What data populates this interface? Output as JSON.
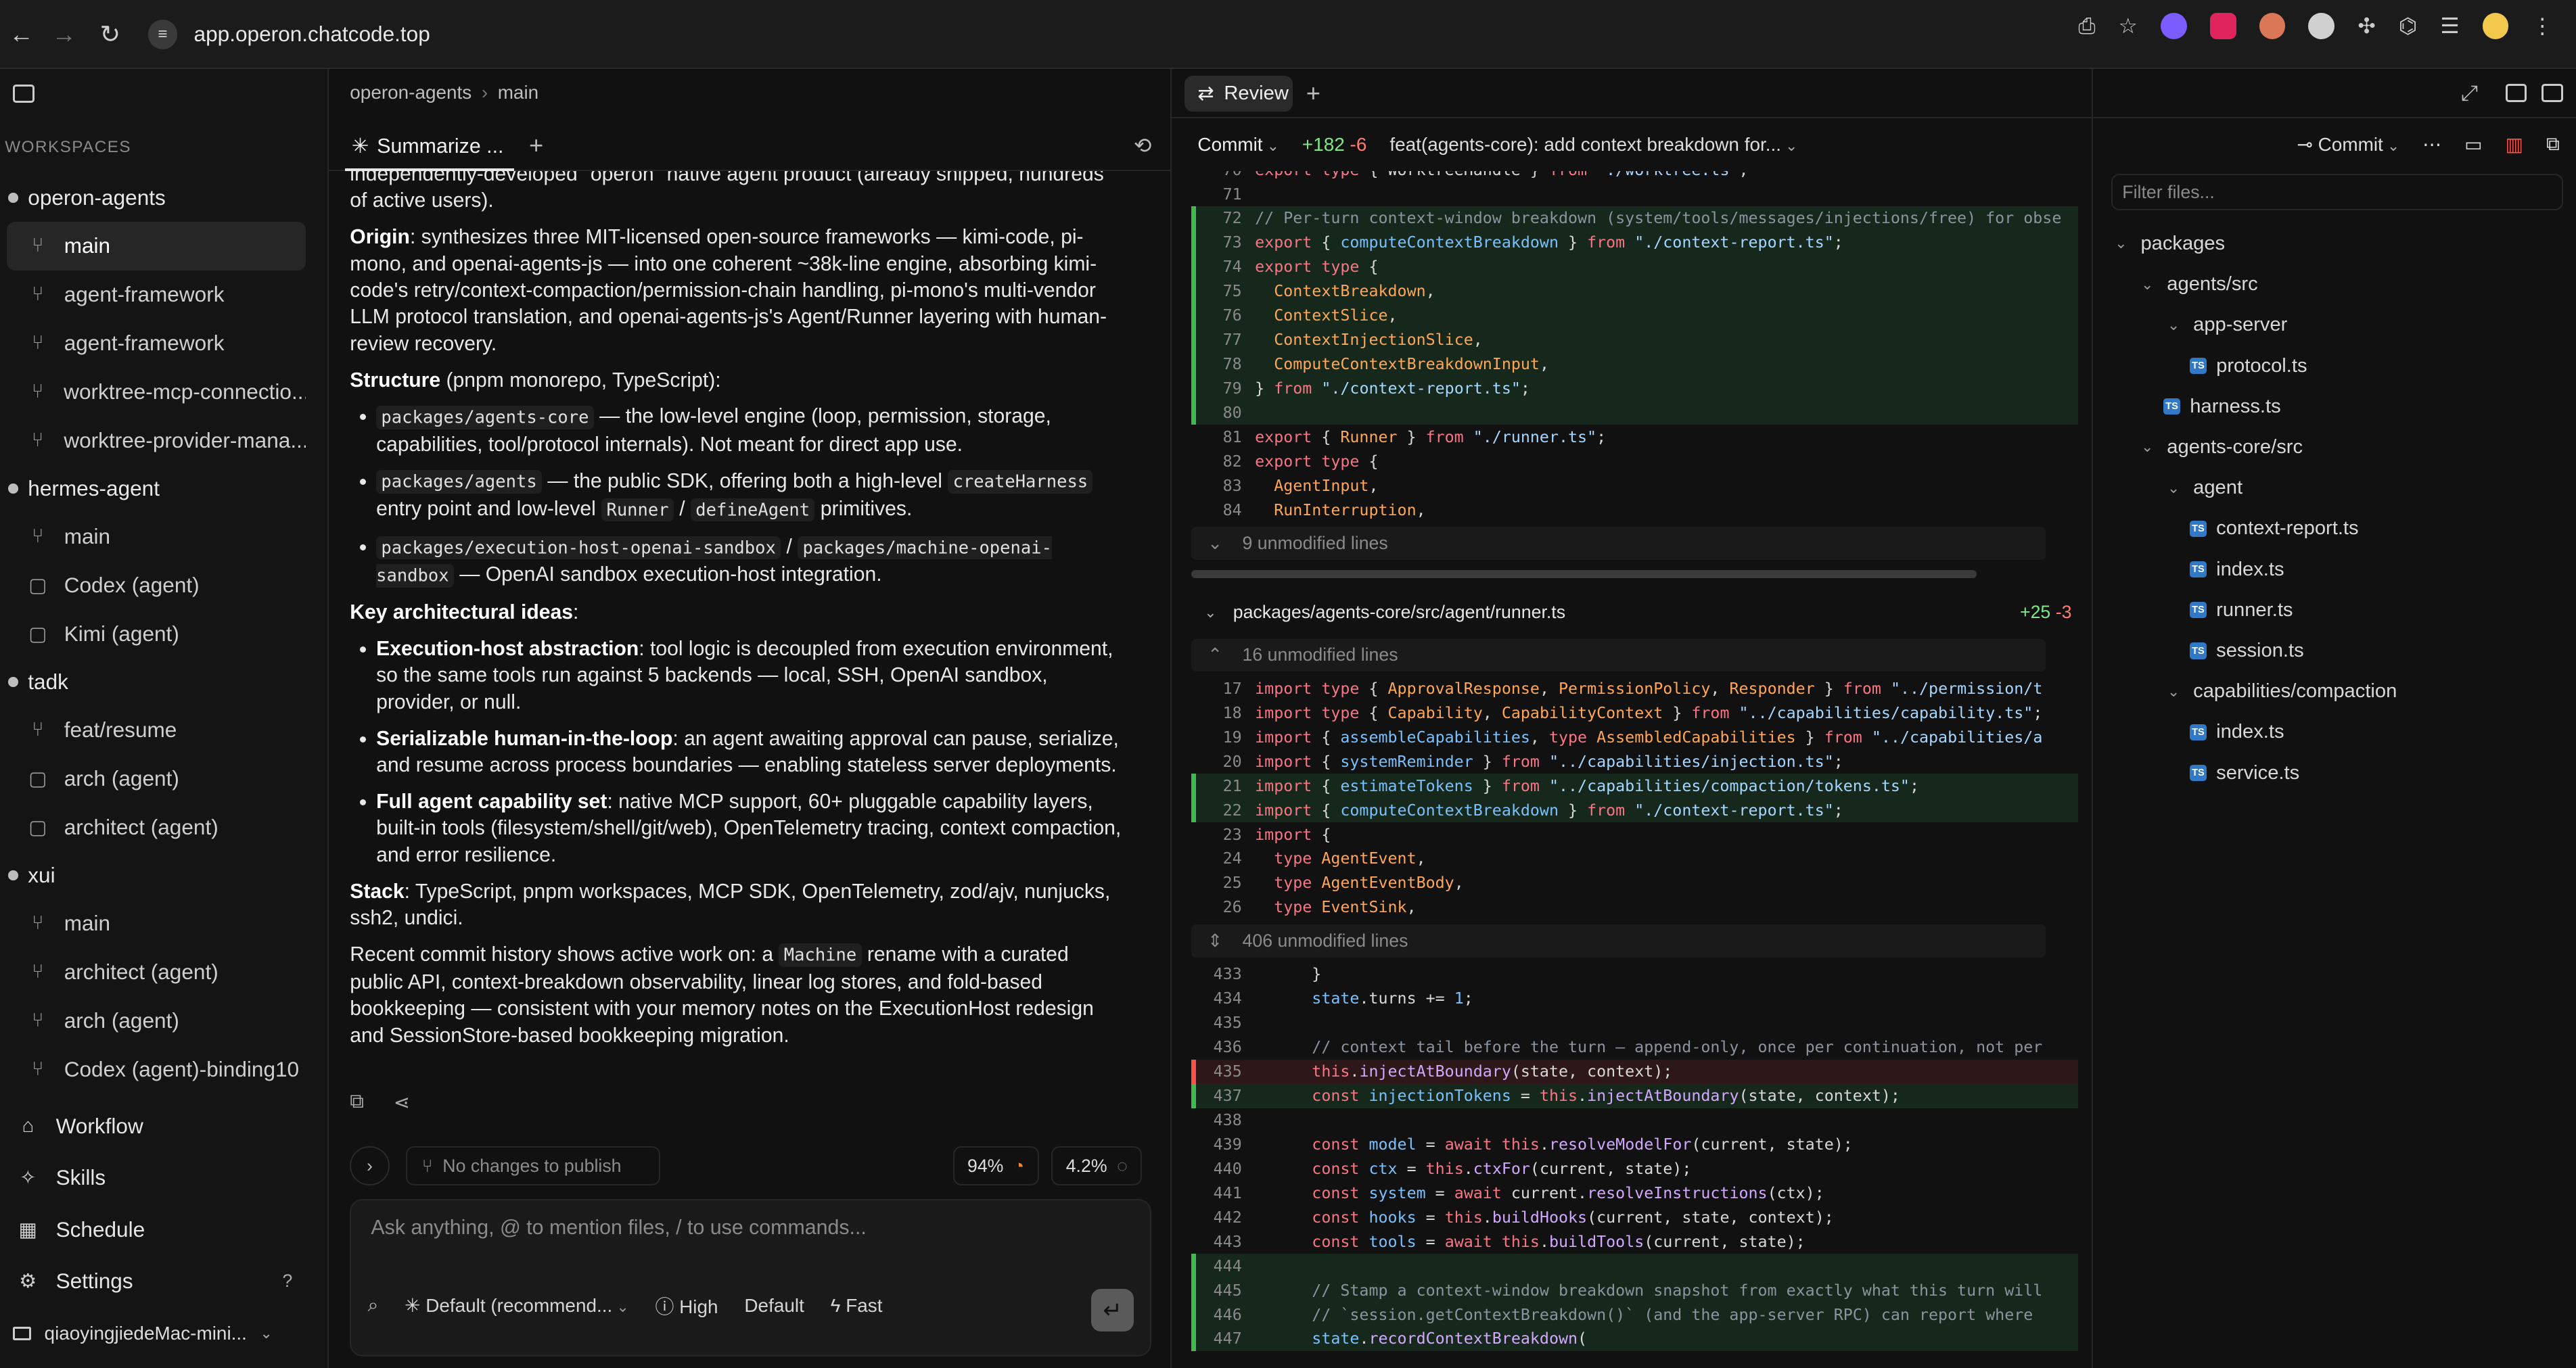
{
  "browser": {
    "url": "app.operon.chatcode.top"
  },
  "sidebar": {
    "section_label": "WORKSPACES",
    "workspaces": [
      {
        "name": "operon-agents",
        "branches": [
          {
            "label": "main",
            "icon": "branch-icon",
            "active": true
          },
          {
            "label": "agent-framework",
            "icon": "branch-icon"
          },
          {
            "label": "agent-framework",
            "icon": "branch-icon"
          },
          {
            "label": "worktree-mcp-connectio...",
            "icon": "branch-icon"
          },
          {
            "label": "worktree-provider-mana...",
            "icon": "branch-icon"
          }
        ]
      },
      {
        "name": "hermes-agent",
        "branches": [
          {
            "label": "main",
            "icon": "branch-icon"
          },
          {
            "label": "Codex (agent)",
            "icon": "briefcase-icon"
          },
          {
            "label": "Kimi (agent)",
            "icon": "briefcase-icon"
          }
        ]
      },
      {
        "name": "tadk",
        "branches": [
          {
            "label": "feat/resume",
            "icon": "branch-icon"
          },
          {
            "label": "arch (agent)",
            "icon": "briefcase-icon"
          },
          {
            "label": "architect (agent)",
            "icon": "briefcase-icon"
          }
        ]
      },
      {
        "name": "xui",
        "branches": [
          {
            "label": "main",
            "icon": "branch-icon"
          },
          {
            "label": "architect (agent)",
            "icon": "branch-icon"
          },
          {
            "label": "arch (agent)",
            "icon": "branch-icon"
          },
          {
            "label": "Codex (agent)-binding10",
            "icon": "branch-icon"
          }
        ]
      }
    ],
    "nav": {
      "workflow": "Workflow",
      "skills": "Skills",
      "schedule": "Schedule",
      "settings": "Settings",
      "help": "?"
    },
    "machine": "qiaoyingjiedeMac-mini..."
  },
  "chat": {
    "breadcrumb": {
      "repo": "operon-agents",
      "sep": "›",
      "branch": "main"
    },
    "tab_label": "Summarize ...",
    "body": {
      "intro_tail": "independently-developed \"operon\" native agent product (already shipped, hundreds of active users).",
      "origin_label": "Origin",
      "origin_text": ": synthesizes three MIT-licensed open-source frameworks — kimi-code, pi-mono, and openai-agents-js — into one coherent ~38k-line engine, absorbing kimi-code's retry/context-compaction/permission-chain handling, pi-mono's multi-vendor LLM protocol translation, and openai-agents-js's Agent/Runner layering with human-review recovery.",
      "structure_label": "Structure",
      "structure_text": " (pnpm monorepo, TypeScript):",
      "s1_code": "packages/agents-core",
      "s1_text": " — the low-level engine (loop, permission, storage, capabilities, tool/protocol internals). Not meant for direct app use.",
      "s2_code": "packages/agents",
      "s2_text_a": " — the public SDK, offering both a high-level ",
      "s2_code2": "createHarness",
      "s2_text_b": " entry point and low-level ",
      "s2_code3": "Runner",
      "s2_slash": " / ",
      "s2_code4": "defineAgent",
      "s2_text_c": " primitives.",
      "s3_code": "packages/execution-host-openai-sandbox",
      "s3_slash": " / ",
      "s3_code2": "packages/machine-openai-sandbox",
      "s3_text": " — OpenAI sandbox execution-host integration.",
      "key_label": "Key architectural ideas",
      "key_colon": ":",
      "k1_label": "Execution-host abstraction",
      "k1_text": ": tool logic is decoupled from execution environment, so the same tools run against 5 backends — local, SSH, OpenAI sandbox, provider, or null.",
      "k2_label": "Serializable human-in-the-loop",
      "k2_text": ": an agent awaiting approval can pause, serialize, and resume across process boundaries — enabling stateless server deployments.",
      "k3_label": "Full agent capability set",
      "k3_text": ": native MCP support, 60+ pluggable capability layers, built-in tools (filesystem/shell/git/web), OpenTelemetry tracing, context compaction, and error resilience.",
      "stack_label": "Stack",
      "stack_text": ": TypeScript, pnpm workspaces, MCP SDK, OpenTelemetry, zod/ajv, nunjucks, ssh2, undici.",
      "recent_a": "Recent commit history shows active work on: a ",
      "recent_code": "Machine",
      "recent_b": " rename with a curated public API, context-breakdown observability, linear log stores, and fold-based bookkeeping — consistent with your memory notes on the ExecutionHost redesign and SessionStore-based bookkeeping migration."
    },
    "status": {
      "publish": "No changes to publish",
      "context_pct": "94%",
      "usage_pct": "4.2%"
    },
    "composer": {
      "placeholder": "Ask anything, @ to mention files, / to use commands...",
      "model": "Default (recommend...",
      "effort": "High",
      "mode": "Default",
      "speed": "Fast"
    }
  },
  "review": {
    "tab_label": "Review",
    "commit_label": "Commit",
    "additions": "+182",
    "deletions": "-6",
    "commit_title": "feat(agents-core): add context breakdown for...",
    "file2": {
      "path": "packages/agents-core/src/agent/runner.ts",
      "additions": "+25",
      "deletions": "-3"
    },
    "unmodified_1": "9 unmodified lines",
    "unmodified_2": "16 unmodified lines",
    "unmodified_3": "406 unmodified lines"
  },
  "files": {
    "commit_label": "Commit",
    "filter_placeholder": "Filter files...",
    "tree": [
      {
        "label": "packages",
        "depth": 0,
        "type": "folder"
      },
      {
        "label": "agents/src",
        "depth": 1,
        "type": "folder"
      },
      {
        "label": "app-server",
        "depth": 2,
        "type": "folder"
      },
      {
        "label": "protocol.ts",
        "depth": 3,
        "type": "ts"
      },
      {
        "label": "harness.ts",
        "depth": 2,
        "type": "ts"
      },
      {
        "label": "agents-core/src",
        "depth": 1,
        "type": "folder"
      },
      {
        "label": "agent",
        "depth": 2,
        "type": "folder"
      },
      {
        "label": "context-report.ts",
        "depth": 3,
        "type": "ts"
      },
      {
        "label": "index.ts",
        "depth": 3,
        "type": "ts"
      },
      {
        "label": "runner.ts",
        "depth": 3,
        "type": "ts"
      },
      {
        "label": "session.ts",
        "depth": 3,
        "type": "ts"
      },
      {
        "label": "capabilities/compaction",
        "depth": 2,
        "type": "folder"
      },
      {
        "label": "index.ts",
        "depth": 3,
        "type": "ts"
      },
      {
        "label": "service.ts",
        "depth": 3,
        "type": "ts"
      }
    ]
  },
  "colors": {
    "accent_add": "#3fb950",
    "accent_del": "#f85149",
    "background": "#111111"
  }
}
